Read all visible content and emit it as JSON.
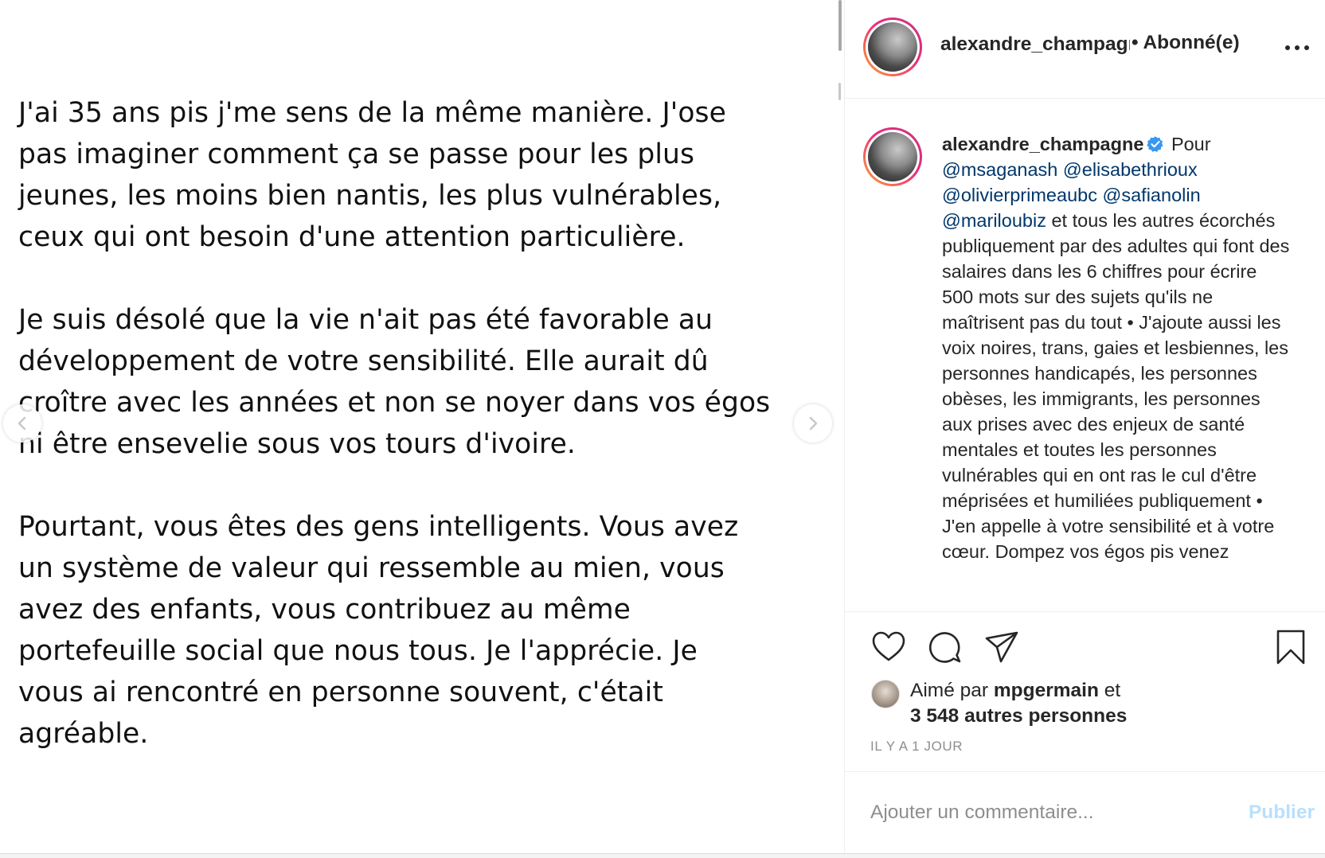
{
  "post": {
    "paragraphs": [
      [
        "J'ai 35 ans pis j'me sens de la même manière. J'ose",
        "pas imaginer comment ça se passe pour les plus",
        "jeunes, les moins bien nantis, les plus vulnérables,",
        "ceux qui ont besoin d'une attention particulière."
      ],
      [
        "Je suis désolé que la vie n'ait pas été favorable au",
        "développement de votre sensibilité. Elle aurait dû",
        "croître avec les années et non se noyer dans vos égos",
        "ni être ensevelie sous vos tours d'ivoire."
      ],
      [
        "Pourtant, vous êtes des gens intelligents. Vous avez",
        "un système de valeur qui ressemble au mien, vous",
        "avez des enfants, vous contribuez au même",
        "portefeuille social que nous tous. Je l'apprécie. Je",
        "vous ai rencontré en personne souvent, c'était",
        "agréable."
      ]
    ]
  },
  "header": {
    "username": "alexandre_champagne",
    "status": "• Abonné(e)"
  },
  "caption": {
    "username": "alexandre_champagne",
    "intro": "Pour",
    "mentions": [
      "@msaganash",
      "@elisabethrioux",
      "@olivierprimeaubc",
      "@safianolin",
      "@mariloubiz"
    ],
    "text": "et tous les autres écorchés publiquement par des adultes qui font des salaires dans les 6 chiffres pour écrire 500 mots sur des sujets qu'ils ne maîtrisent pas du tout • J'ajoute aussi les voix noires, trans, gaies et lesbiennes, les personnes handicapés, les personnes obèses, les immigrants, les personnes aux prises avec des enjeux de santé mentales et toutes les personnes vulnérables qui en ont ras le cul d'être méprisées et humiliées publiquement • J'en appelle à votre sensibilité et à votre cœur. Dompez vos égos pis venez"
  },
  "likes": {
    "prefix": "Aimé par",
    "user": "mpgermain",
    "conjunction": "et",
    "others": "3 548 autres personnes"
  },
  "timestamp": "IL Y A 1 JOUR",
  "comment": {
    "placeholder": "Ajouter un commentaire...",
    "publish_label": "Publier"
  },
  "icons": {
    "verified": "verified-badge-icon",
    "more": "more-options-icon",
    "like": "heart-icon",
    "comment": "comment-icon",
    "share": "paper-plane-icon",
    "save": "bookmark-icon",
    "prev": "chevron-left-icon",
    "next": "chevron-right-icon"
  },
  "colors": {
    "mention": "#00376b",
    "verified": "#3897f0",
    "publish_disabled": "#b9dffc",
    "muted": "#8e8e8e"
  }
}
